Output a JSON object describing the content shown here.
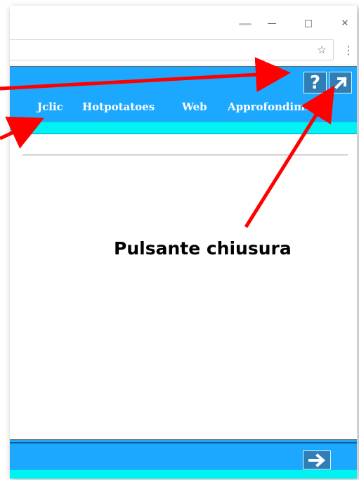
{
  "window": {
    "minimize_icon": "minimize-icon",
    "maximize_icon": "maximize-icon",
    "close_icon": "close-icon"
  },
  "toolbar": {
    "bookmark_icon": "star-icon",
    "menu_icon": "more-options-icon"
  },
  "app": {
    "accent_blue": "#1ca8ff",
    "accent_cyan": "#00f2f2",
    "button_blue": "#2f7fb6",
    "help_label": "?",
    "nav": [
      {
        "label": "Jclic"
      },
      {
        "label": "Hotpotatoes"
      },
      {
        "label": "Web"
      },
      {
        "label": "Approfondimento"
      }
    ],
    "close_icon": "arrow-up-right-icon",
    "next_icon": "arrow-right-icon"
  },
  "annotation": {
    "label": "Pulsante chiusura",
    "arrow_color": "#ff0000"
  }
}
